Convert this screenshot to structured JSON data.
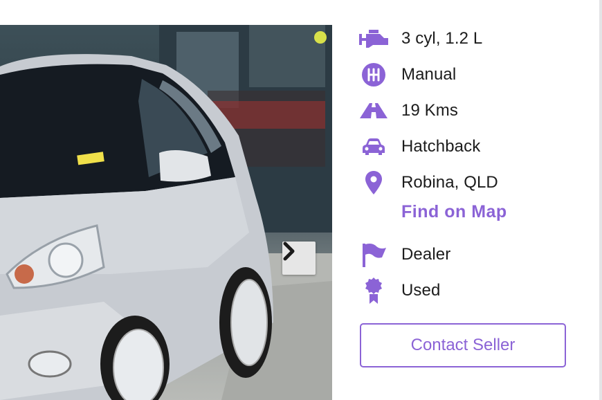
{
  "listing": {
    "photo": {
      "alt": "silver-hatchback-photo"
    },
    "gallery": {
      "next_icon": "chevron-right-icon"
    },
    "specs": [
      {
        "icon": "engine-icon",
        "label": "3 cyl, 1.2 L"
      },
      {
        "icon": "gear-shift-icon",
        "label": "Manual"
      },
      {
        "icon": "road-icon",
        "label": "19 Kms"
      },
      {
        "icon": "car-icon",
        "label": "Hatchback"
      },
      {
        "icon": "location-pin-icon",
        "label": "Robina, QLD"
      },
      {
        "icon": "flag-icon",
        "label": "Dealer"
      },
      {
        "icon": "badge-icon",
        "label": "Used"
      }
    ],
    "find_on_map": "Find on Map",
    "contact_button": "Contact Seller"
  },
  "colors": {
    "accent": "#8b63d6",
    "text": "#1c1c1c",
    "nav_button": "#e6e6e6"
  }
}
